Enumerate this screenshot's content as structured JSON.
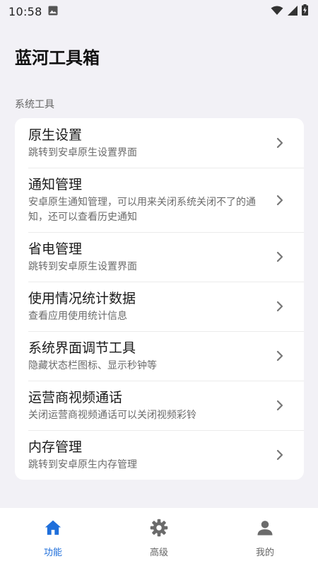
{
  "status_bar": {
    "time": "10:58",
    "icons": [
      "image-icon",
      "wifi-icon",
      "signal-icon",
      "battery-charging-icon"
    ]
  },
  "app_title": "蓝河工具箱",
  "section_label": "系统工具",
  "items": [
    {
      "title": "原生设置",
      "desc": "跳转到安卓原生设置界面"
    },
    {
      "title": "通知管理",
      "desc": "安卓原生通知管理，可以用来关闭系统关闭不了的通知，还可以查看历史通知"
    },
    {
      "title": "省电管理",
      "desc": "跳转到安卓原生设置界面"
    },
    {
      "title": "使用情况统计数据",
      "desc": "查看应用使用统计信息"
    },
    {
      "title": "系统界面调节工具",
      "desc": "隐藏状态栏图标、显示秒钟等"
    },
    {
      "title": "运营商视频通话",
      "desc": "关闭运营商视频通话可以关闭视频彩铃"
    },
    {
      "title": "内存管理",
      "desc": "跳转到安卓原生内存管理"
    }
  ],
  "bottom_nav": {
    "tabs": [
      {
        "label": "功能",
        "icon": "home-icon",
        "active": true
      },
      {
        "label": "高级",
        "icon": "gear-icon",
        "active": false
      },
      {
        "label": "我的",
        "icon": "person-icon",
        "active": false
      }
    ]
  },
  "colors": {
    "background": "#f2f1f6",
    "card": "#ffffff",
    "accent": "#1f6fdb",
    "inactive_icon": "#6b6b6b"
  }
}
